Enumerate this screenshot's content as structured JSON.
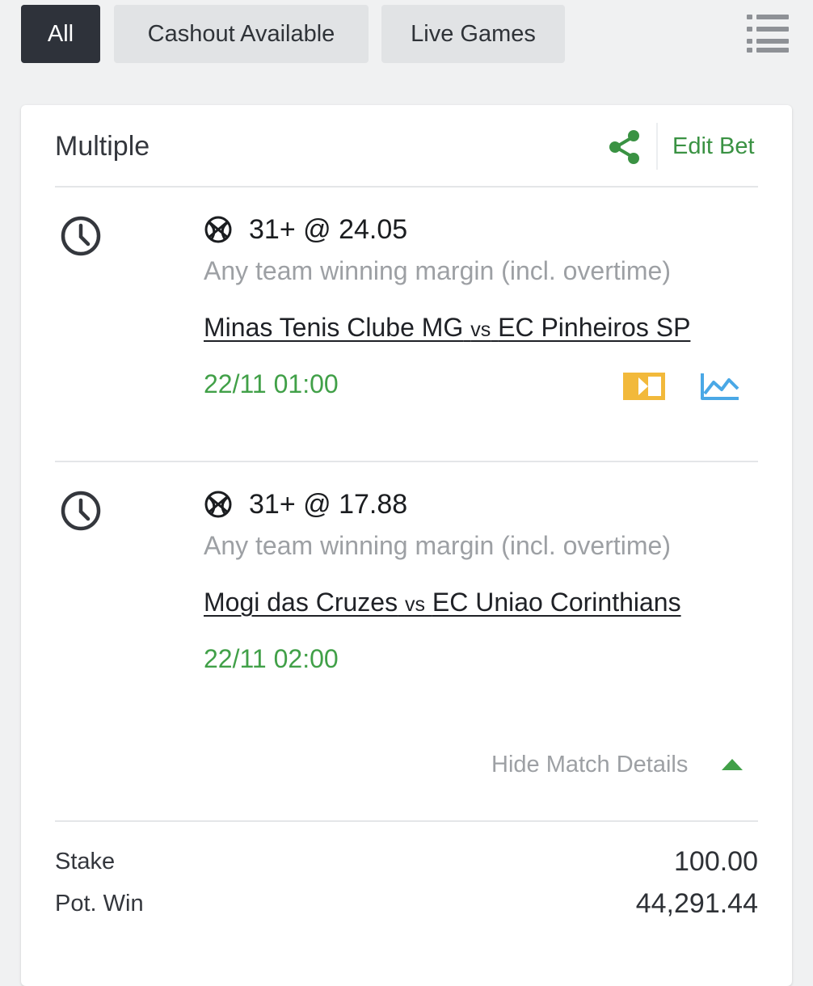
{
  "filters": [
    {
      "label": "All",
      "active": true
    },
    {
      "label": "Cashout Available",
      "active": false
    },
    {
      "label": "Live Games",
      "active": false
    }
  ],
  "icons": {
    "menu": "list-menu-icon",
    "share": "share-icon",
    "clock": "clock-icon",
    "sport": "basketball-icon",
    "tv": "live-tv-icon",
    "stats": "stats-chart-icon",
    "caret": "caret-up-icon"
  },
  "colors": {
    "active_filter": "#2e323a",
    "accent_green": "#3a9243",
    "kickoff_green": "#41a048",
    "tv_yellow": "#f2b93b",
    "stats_blue": "#4aa8e6"
  },
  "bet": {
    "type": "Multiple",
    "edit_label": "Edit Bet",
    "selections": [
      {
        "pick": "31+ @ 24.05",
        "market": "Any team winning margin (incl. overtime)",
        "home": "Minas Tenis Clube MG",
        "vs": "vs",
        "away": "EC Pinheiros SP",
        "kickoff": "22/11 01:00",
        "has_tv": true,
        "has_stats": true
      },
      {
        "pick": "31+ @ 17.88",
        "market": "Any team winning margin (incl. overtime)",
        "home": "Mogi das Cruzes",
        "vs": "vs",
        "away": "EC Uniao Corinthians",
        "kickoff": "22/11 02:00",
        "has_tv": false,
        "has_stats": false
      }
    ],
    "hide_details_label": "Hide Match Details",
    "stake_label": "Stake",
    "stake_value": "100.00",
    "pot_win_label": "Pot. Win",
    "pot_win_value": "44,291.44"
  }
}
